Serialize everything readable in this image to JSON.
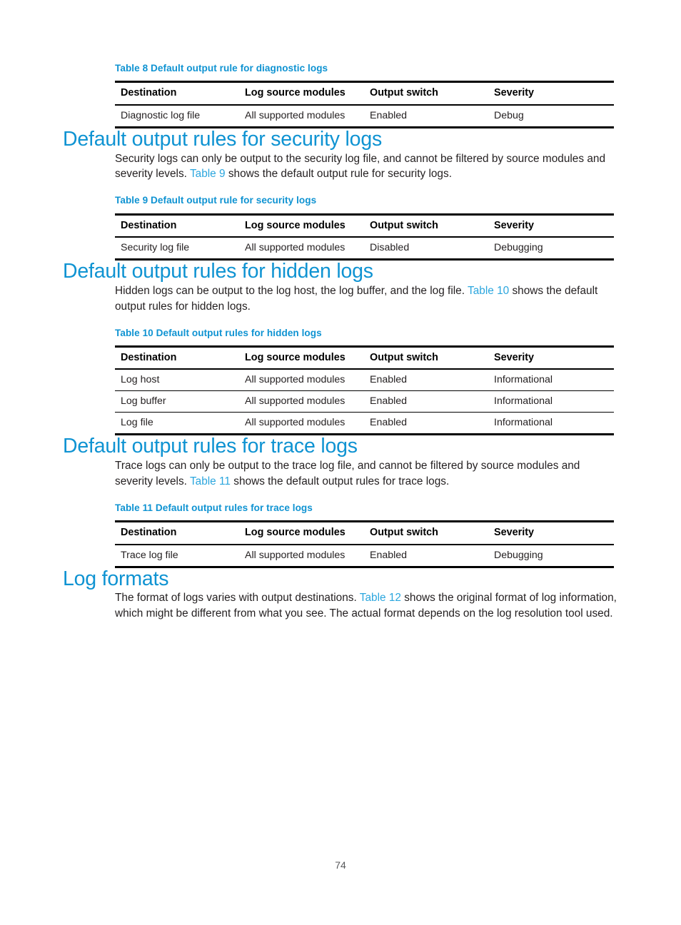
{
  "document": {
    "page_number": "74",
    "heading_color": "#0f93d2",
    "xref_color": "#2ba6de",
    "text_color": "#231f20"
  },
  "table8": {
    "caption": "Table 8 Default output rule for diagnostic logs",
    "headers": [
      "Destination",
      "Log source modules",
      "Output switch",
      "Severity"
    ],
    "rows": [
      [
        "Diagnostic log file",
        "All supported modules",
        "Enabled",
        "Debug"
      ]
    ]
  },
  "security_section": {
    "heading": "Default output rules for security logs",
    "paragraph": {
      "part1": "Security logs can only be output to the security log file, and cannot be filtered by source modules and severity levels. ",
      "xref": "Table 9",
      "part2": " shows the default output rule for security logs."
    }
  },
  "table9": {
    "caption": "Table 9 Default output rule for security logs",
    "headers": [
      "Destination",
      "Log source modules",
      "Output switch",
      "Severity"
    ],
    "rows": [
      [
        "Security log file",
        "All supported modules",
        "Disabled",
        "Debugging"
      ]
    ]
  },
  "hidden_section": {
    "heading": "Default output rules for hidden logs",
    "paragraph": {
      "part1": "Hidden logs can be output to the log host, the log buffer, and the log file. ",
      "xref": "Table 10",
      "part2": " shows the default output rules for hidden logs."
    }
  },
  "table10": {
    "caption": "Table 10 Default output rules for hidden logs",
    "headers": [
      "Destination",
      "Log source modules",
      "Output switch",
      "Severity"
    ],
    "rows": [
      [
        "Log host",
        "All supported modules",
        "Enabled",
        "Informational"
      ],
      [
        "Log buffer",
        "All supported modules",
        "Enabled",
        "Informational"
      ],
      [
        "Log file",
        "All supported modules",
        "Enabled",
        "Informational"
      ]
    ]
  },
  "trace_section": {
    "heading": "Default output rules for trace logs",
    "paragraph": {
      "part1": "Trace logs can only be output to the trace log file, and cannot be filtered by source modules and severity levels. ",
      "xref": "Table 11",
      "part2": " shows the default output rules for trace logs."
    }
  },
  "table11": {
    "caption": "Table 11 Default output rules for trace logs",
    "headers": [
      "Destination",
      "Log source modules",
      "Output switch",
      "Severity"
    ],
    "rows": [
      [
        "Trace log file",
        "All supported modules",
        "Enabled",
        "Debugging"
      ]
    ]
  },
  "logformats_section": {
    "heading": "Log formats",
    "paragraph": {
      "part1": "The format of logs varies with output destinations. ",
      "xref": "Table 12",
      "part2": " shows the original format of log information, which might be different from what you see. The actual format depends on the log resolution tool used."
    }
  }
}
